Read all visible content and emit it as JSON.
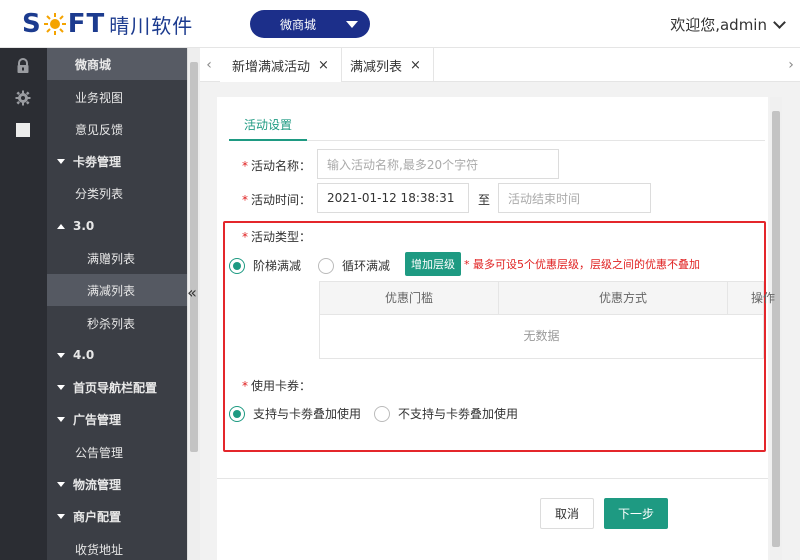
{
  "header": {
    "logo_text": "SOFT",
    "logo_cn": "晴川软件",
    "app_switch_label": "微商城",
    "welcome": "欢迎您,admin"
  },
  "rail": {
    "icons": [
      "lock-icon",
      "gear-icon",
      "square-icon"
    ]
  },
  "sidebar": {
    "items": [
      {
        "label": "微商城",
        "kind": "app"
      },
      {
        "label": "业务视图",
        "kind": "sub"
      },
      {
        "label": "意见反馈",
        "kind": "sub"
      },
      {
        "label": "卡劵管理",
        "kind": "group-open"
      },
      {
        "label": "分类列表",
        "kind": "sub"
      },
      {
        "label": "3.0",
        "kind": "group-expanded"
      },
      {
        "label": "满赠列表",
        "kind": "sub2"
      },
      {
        "label": "满减列表",
        "kind": "sub2-selected"
      },
      {
        "label": "秒杀列表",
        "kind": "sub2"
      },
      {
        "label": "4.0",
        "kind": "group-open"
      },
      {
        "label": "首页导航栏配置",
        "kind": "group-open"
      },
      {
        "label": "广告管理",
        "kind": "group-open"
      },
      {
        "label": "公告管理",
        "kind": "sub"
      },
      {
        "label": "物流管理",
        "kind": "group-open"
      },
      {
        "label": "商户配置",
        "kind": "group-open"
      },
      {
        "label": "收货地址",
        "kind": "sub"
      }
    ],
    "collapse_glyph": "«"
  },
  "tabs": {
    "left_arrow": "‹",
    "right_arrow": "›",
    "items": [
      {
        "label": "新增满减活动",
        "close": "×"
      },
      {
        "label": "满减列表",
        "close": "×"
      }
    ]
  },
  "form": {
    "subtab": "活动设置",
    "name_label": "活动名称：",
    "name_placeholder": "输入活动名称,最多20个字符",
    "time_label": "活动时间：",
    "time_start": "2021-01-12 18:38:31",
    "time_between": "至",
    "time_end_placeholder": "活动结束时间",
    "type_label": "活动类型：",
    "type_options": [
      {
        "label": "阶梯满减",
        "selected": true
      },
      {
        "label": "循环满减",
        "selected": false
      }
    ],
    "add_level_button": "增加层级",
    "warning": "* 最多可设5个优惠层级，层级之间的优惠不叠加",
    "table": {
      "headers": [
        "优惠门槛",
        "优惠方式",
        "操作"
      ],
      "empty_text": "无数据"
    },
    "coupon_label": "使用卡券：",
    "coupon_options": [
      {
        "label": "支持与卡劵叠加使用",
        "selected": true
      },
      {
        "label": "不支持与卡劵叠加使用",
        "selected": false
      }
    ],
    "required_mark": "*"
  },
  "footer": {
    "cancel": "取消",
    "next": "下一步"
  },
  "colors": {
    "accent": "#1e9a82",
    "brand": "#1c3b8f",
    "highlight_border": "#e4262b",
    "warning_text": "#e02020",
    "sidebar_bg": "#3b3e45",
    "rail_bg": "#2b2d33"
  }
}
